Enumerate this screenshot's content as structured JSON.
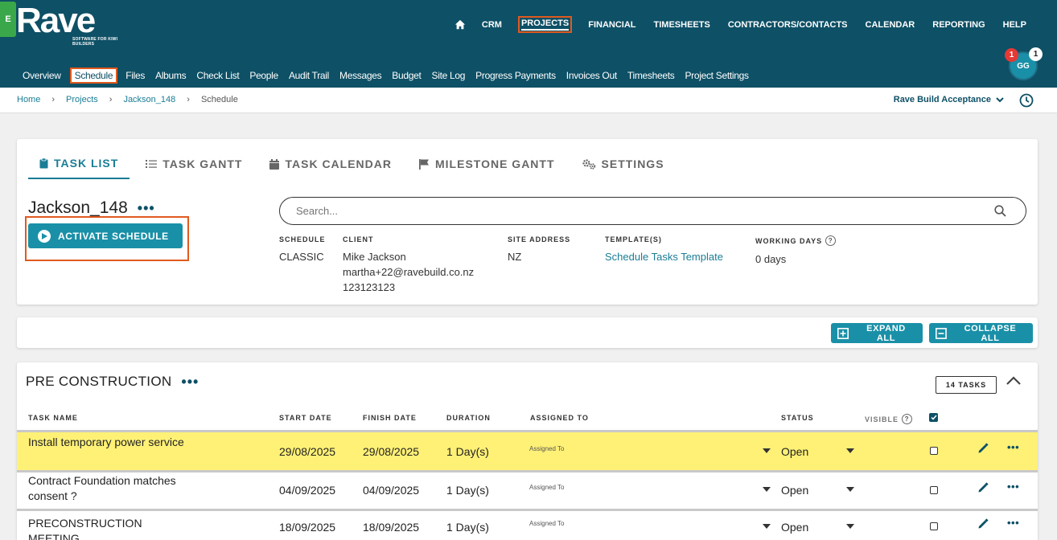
{
  "side_tab": "E",
  "logo": {
    "name": "Rave",
    "tagline": "SOFTWARE FOR KIWI BUILDERS"
  },
  "topnav": [
    "CRM",
    "PROJECTS",
    "FINANCIAL",
    "TIMESHEETS",
    "CONTRACTORS/CONTACTS",
    "CALENDAR",
    "REPORTING",
    "HELP"
  ],
  "user": {
    "initials": "GG",
    "badge_red": "1",
    "badge_white": "1"
  },
  "subnav": [
    "Overview",
    "Schedule",
    "Files",
    "Albums",
    "Check List",
    "People",
    "Audit Trail",
    "Messages",
    "Budget",
    "Site Log",
    "Progress Payments",
    "Invoices Out",
    "Timesheets",
    "Project Settings"
  ],
  "breadcrumb": [
    "Home",
    "Projects",
    "Jackson_148",
    "Schedule"
  ],
  "project_select": "Rave Build Acceptance",
  "tabs": [
    "TASK LIST",
    "TASK GANTT",
    "TASK CALENDAR",
    "MILESTONE GANTT",
    "SETTINGS"
  ],
  "project": {
    "title": "Jackson_148",
    "activate_label": "ACTIVATE SCHEDULE",
    "search_placeholder": "Search...",
    "schedule_label": "SCHEDULE",
    "schedule_value": "CLASSIC",
    "client_label": "CLIENT",
    "client_name": "Mike Jackson",
    "client_email": "martha+22@ravebuild.co.nz",
    "client_phone": "123123123",
    "site_label": "SITE ADDRESS",
    "site_value": "NZ",
    "template_label": "TEMPLATE(S)",
    "template_value": "Schedule Tasks Template",
    "working_label": "WORKING DAYS",
    "working_value": "0 days"
  },
  "actions": {
    "expand": "EXPAND ALL",
    "collapse": "COLLAPSE ALL"
  },
  "section": {
    "title": "PRE CONSTRUCTION",
    "tasks_count": "14 TASKS",
    "headers": {
      "task": "TASK NAME",
      "start": "START DATE",
      "finish": "FINISH DATE",
      "duration": "DURATION",
      "assigned": "ASSIGNED TO",
      "status": "STATUS",
      "visible": "VISIBLE"
    },
    "rows": [
      {
        "name": "Install temporary power service",
        "start": "29/08/2025",
        "finish": "29/08/2025",
        "duration": "1 Day(s)",
        "assigned": "Assigned To",
        "status": "Open"
      },
      {
        "name": "Contract Foundation matches consent ?",
        "start": "04/09/2025",
        "finish": "04/09/2025",
        "duration": "1 Day(s)",
        "assigned": "Assigned To",
        "status": "Open"
      },
      {
        "name": "PRECONSTRUCTION MEETING",
        "start": "18/09/2025",
        "finish": "18/09/2025",
        "duration": "1 Day(s)",
        "assigned": "Assigned To",
        "status": "Open"
      }
    ]
  },
  "colors": {
    "header_bg": "#0e5066",
    "accent": "#1a90a8",
    "highlight_outline": "#e05a1f",
    "row_highlight": "#fff176"
  }
}
